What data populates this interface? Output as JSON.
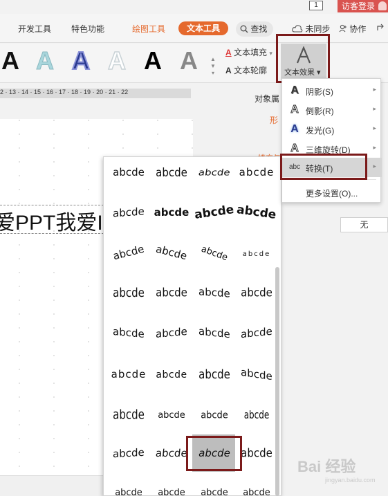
{
  "top": {
    "page_number": "1",
    "login_label": "访客登录"
  },
  "tabs": {
    "dev_tools": "开发工具",
    "special": "特色功能",
    "draw_tools": "绘图工具",
    "text_tools": "文本工具",
    "search": "查找",
    "unsynced": "未同步",
    "collab": "协作"
  },
  "ribbon": {
    "art_letter": "A",
    "text_fill": "文本填充",
    "text_outline": "文本轮廓",
    "text_effect": "文本效果"
  },
  "ruler": {
    "ticks": "2 · 13 · 14 · 15 · 16 · 17 · 18 · 19 · 20 · 21 · 22"
  },
  "slide": {
    "text": "爱PPT我爱I"
  },
  "pane": {
    "title": "对象属",
    "tab": "形",
    "sub": "填充与",
    "none_button": "无"
  },
  "menu": {
    "items": [
      {
        "icon": "shadow-icon",
        "glyph": "A",
        "label": "阴影(S)",
        "has_arrow": true
      },
      {
        "icon": "reflection-icon",
        "glyph": "A",
        "label": "倒影(R)",
        "has_arrow": true
      },
      {
        "icon": "glow-icon",
        "glyph": "A",
        "label": "发光(G)",
        "has_arrow": true
      },
      {
        "icon": "3d-rotation-icon",
        "glyph": "A",
        "label": "三维旋转(D)",
        "has_arrow": true
      },
      {
        "icon": "transform-icon",
        "glyph": "abc",
        "label": "转换(T)",
        "has_arrow": true
      },
      {
        "icon": "none",
        "glyph": "",
        "label": "更多设置(O)...",
        "has_arrow": false
      }
    ]
  },
  "gallery": {
    "sample": "abcde",
    "rows": [
      [
        "abcde",
        "abcde",
        "abcde",
        "abcde"
      ],
      [
        "abcde",
        "abcde",
        "abcde",
        "abcde"
      ],
      [
        "abcde",
        "abcde",
        "abcde",
        "abcde"
      ],
      [
        "abcde",
        "abcde",
        "abcde",
        "abcde"
      ],
      [
        "abcde",
        "abcde",
        "abcde",
        "abcde"
      ],
      [
        "abcde",
        "abcde",
        "abcde",
        "abcde"
      ],
      [
        "abcde",
        "abcde",
        "abcde",
        "abcde"
      ],
      [
        "abcde",
        "abcde",
        "abcde",
        "abcde"
      ],
      [
        "abcde",
        "abcde",
        "abcde",
        "abcde"
      ]
    ]
  },
  "watermark": {
    "text": "Bai 经验",
    "url": "jingyan.baidu.com"
  },
  "colors": {
    "accent": "#e5692d",
    "highlight_border": "#7b1a1a",
    "login": "#d9534f"
  }
}
